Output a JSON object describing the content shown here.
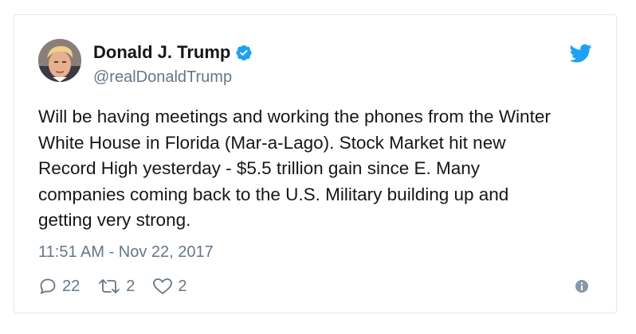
{
  "author": {
    "name": "Donald J. Trump",
    "handle": "@realDonaldTrump",
    "avatar_icon": "profile-photo",
    "verified_icon": "verified-badge-icon"
  },
  "tweet": {
    "text": "Will be having meetings and working the phones from the Winter\nWhite House in Florida (Mar-a-Lago). Stock Market hit new\nRecord High yesterday - $5.5 trillion gain since E. Many\ncompanies coming back to the U.S. Military building up and\ngetting very strong.",
    "timestamp": "11:51 AM - Nov 22, 2017"
  },
  "actions": {
    "reply_count": "22",
    "retweet_count": "2",
    "like_count": "2"
  },
  "colors": {
    "brand": "#1da1f2",
    "text": "#14171a",
    "muted": "#657786",
    "border": "#e1e8ed"
  }
}
